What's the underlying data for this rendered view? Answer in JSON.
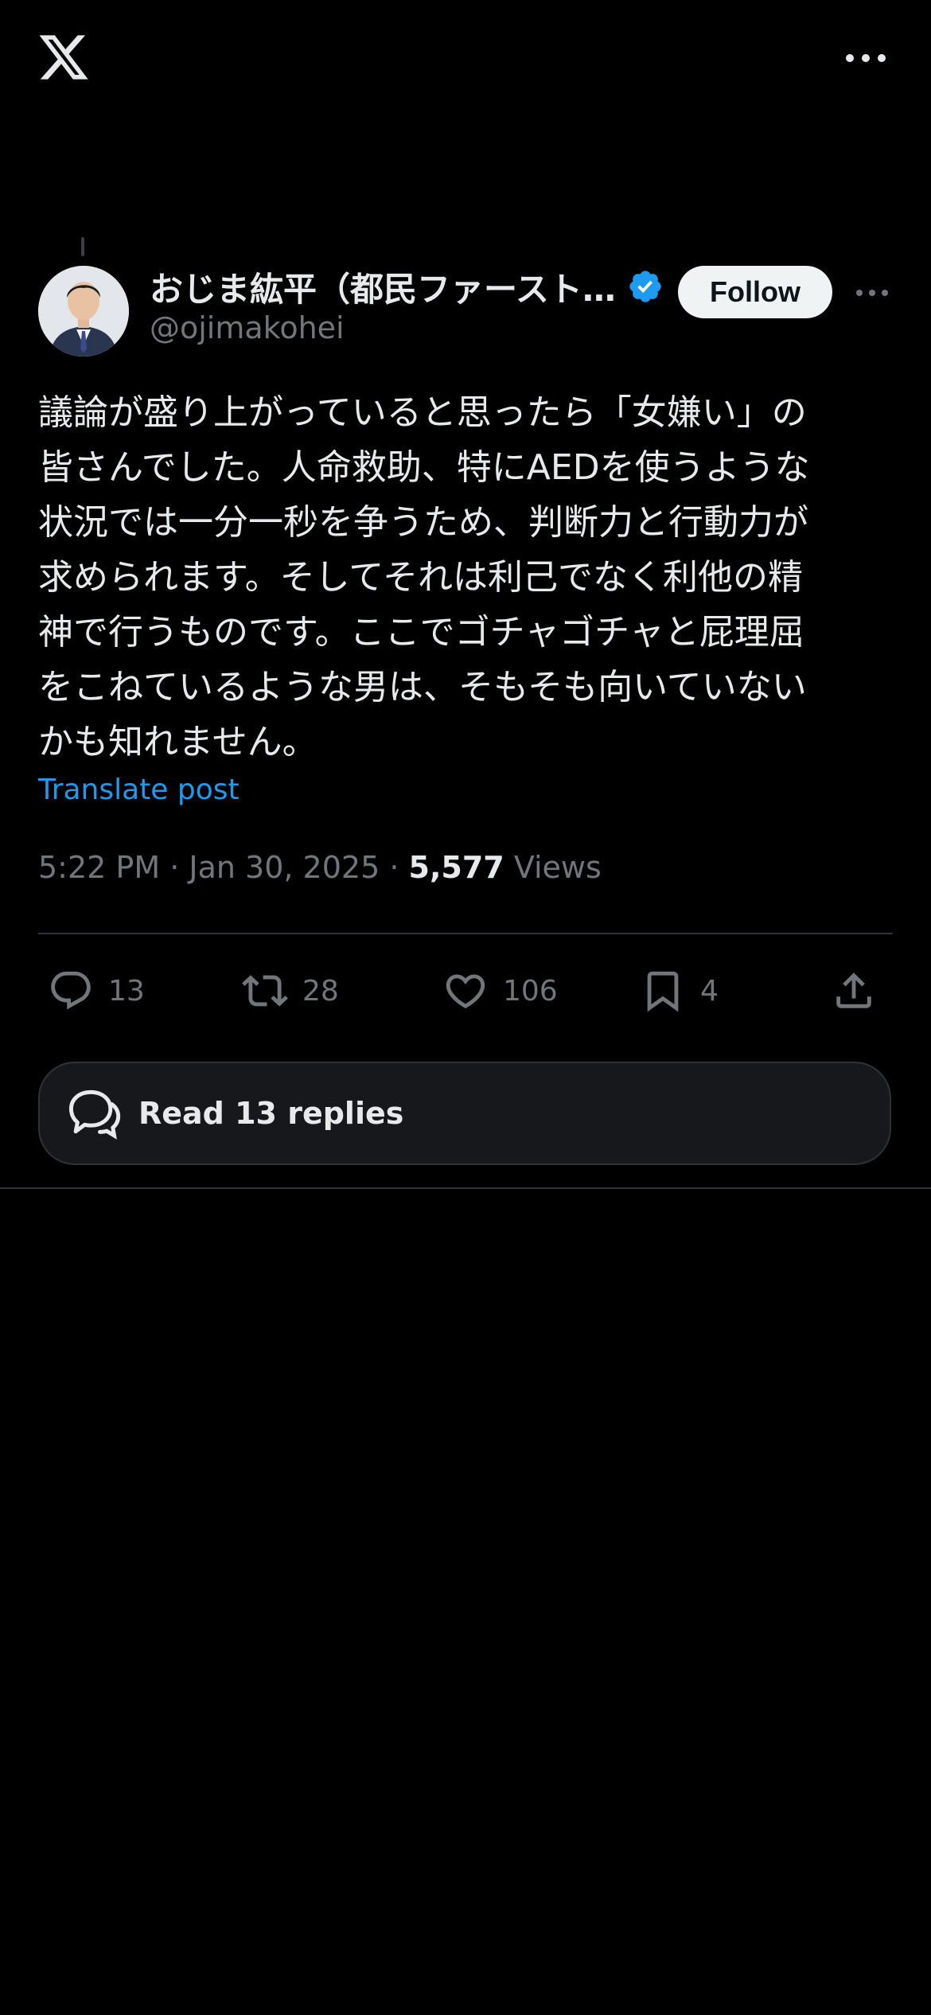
{
  "header": {
    "logo_icon": "x-logo-icon",
    "more_icon": "more-horizontal-icon"
  },
  "author": {
    "display_name": "おじま紘平（都民ファースト…",
    "handle": "@ojimakohei",
    "verified": true,
    "verified_color": "#1d9bf0",
    "follow_label": "Follow"
  },
  "post": {
    "text": "議論が盛り上がっていると思ったら「女嫌い」の\n皆さんでした。人命救助、特にAEDを使うような\n状況では一分一秒を争うため、判断力と行動力が\n求められます。そしてそれは利己でなく利他の精\n神で行うものです。ここでゴチャゴチャと屁理屈\nをこねているような男は、そもそも向いていない\nかも知れません。",
    "translate_label": "Translate post",
    "time": "5:22 PM",
    "date": "Jan 30, 2025",
    "views_count": "5,577",
    "views_label": "Views"
  },
  "actions": {
    "replies": "13",
    "reposts": "28",
    "likes": "106",
    "bookmarks": "4"
  },
  "read_replies": {
    "label": "Read 13 replies"
  },
  "colors": {
    "background": "#000000",
    "text": "#e7e9ea",
    "muted": "#71767b",
    "link": "#1d9bf0",
    "divider": "#2f3336"
  }
}
